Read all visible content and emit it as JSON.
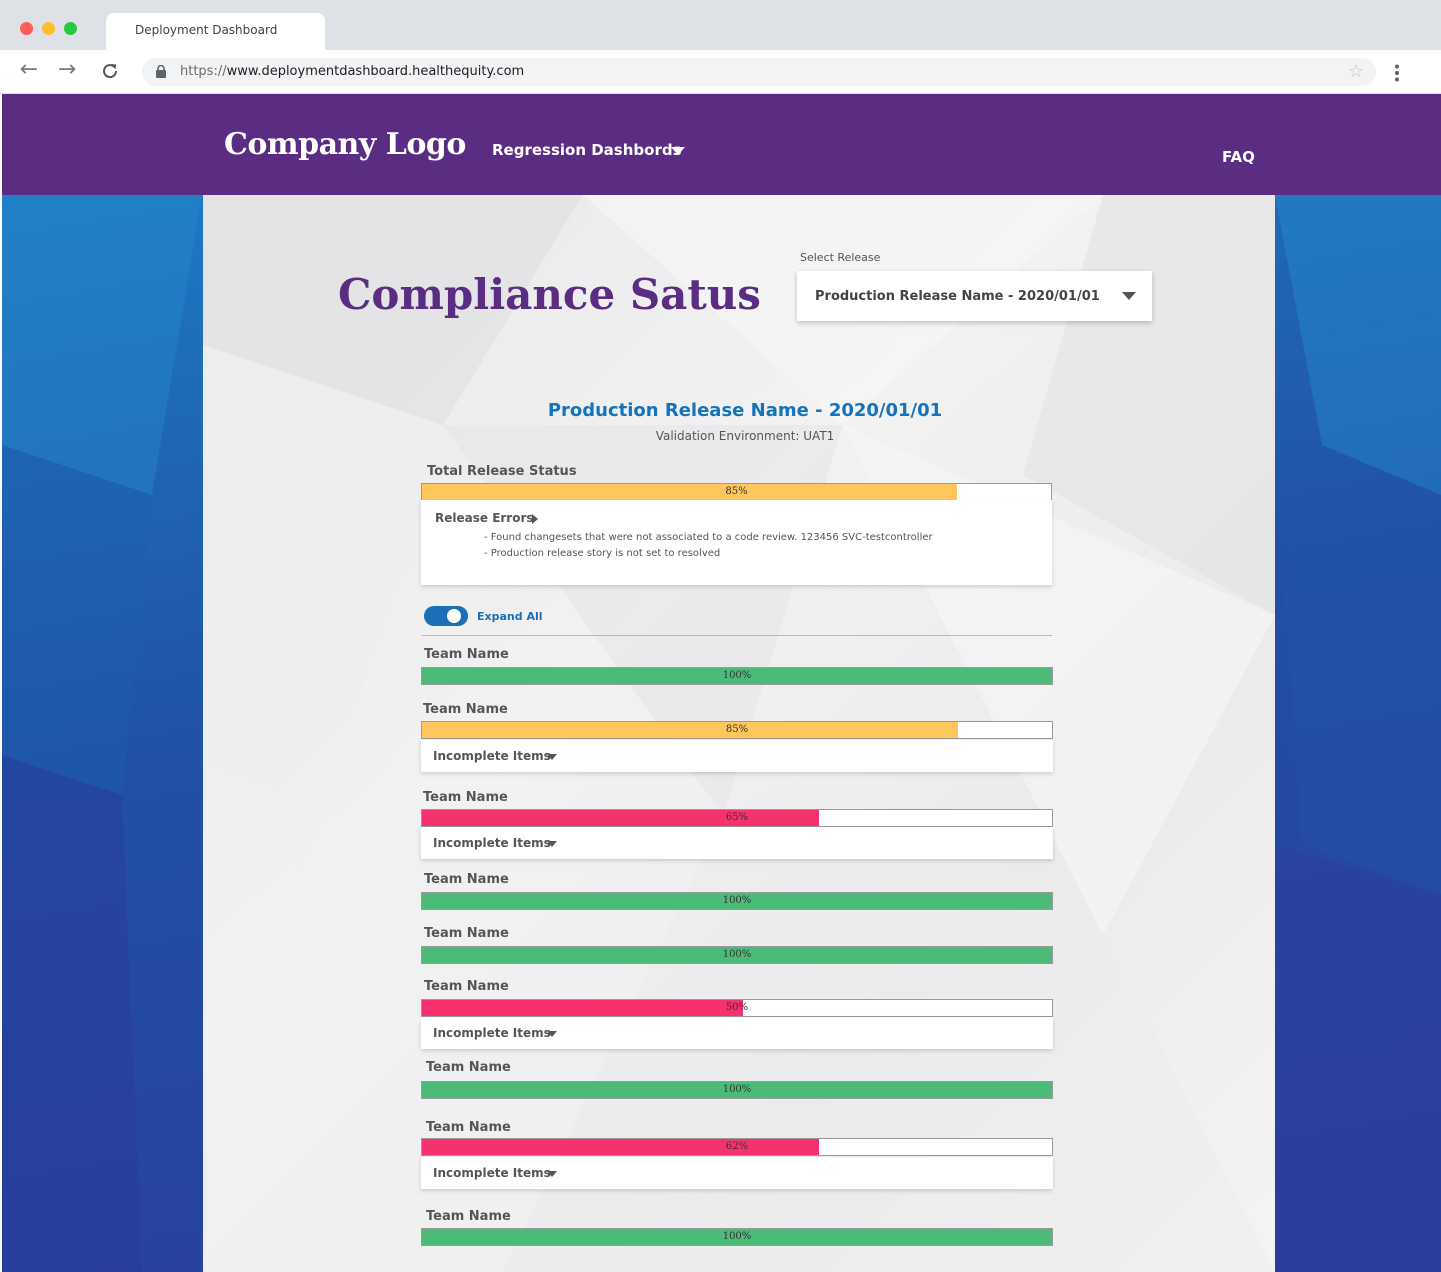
{
  "browser": {
    "tab_title": "Deployment Dashboard",
    "url_scheme": "https://",
    "url_host": "www.deploymentdashboard.healthequity.com"
  },
  "header": {
    "logo": "Company Logo",
    "nav_regression": "Regression Dashbords",
    "nav_faq": "FAQ"
  },
  "page": {
    "title": "Compliance Satus",
    "select_label": "Select Release",
    "selected_release": "Production Release Name - 2020/01/01",
    "release_title": "Production Release Name - 2020/01/01",
    "release_env": "Validation Environment: UAT1"
  },
  "total": {
    "label": "Total Release Status",
    "percent_text": "85%",
    "percent": 85,
    "color": "#ffc65c"
  },
  "errors": {
    "title": "Release Errors",
    "lines": [
      "- Found changesets that were not associated to a code review. 123456 SVC-testcontroller",
      "- Production release story is not set to resolved"
    ]
  },
  "expand_all": "Expand All",
  "colors": {
    "green": "#4cbb7a",
    "yellow": "#ffc65c",
    "red": "#f5326d"
  },
  "teams": [
    {
      "name": "Team Name",
      "percent": 100,
      "percent_text": "100%",
      "status": "green"
    },
    {
      "name": "Team Name",
      "percent": 85,
      "percent_text": "85%",
      "status": "yellow",
      "incomplete_label": "Incomplete Items"
    },
    {
      "name": "Team Name",
      "percent": 63,
      "percent_text": "65%",
      "status": "red",
      "incomplete_label": "Incomplete Items"
    },
    {
      "name": "Team Name",
      "percent": 100,
      "percent_text": "100%",
      "status": "green"
    },
    {
      "name": "Team Name",
      "percent": 100,
      "percent_text": "100%",
      "status": "green"
    },
    {
      "name": "Team Name",
      "percent": 51,
      "percent_text": "50%",
      "status": "red",
      "incomplete_label": "Incomplete Items"
    },
    {
      "name": "Team Name",
      "percent": 100,
      "percent_text": "100%",
      "status": "green"
    },
    {
      "name": "Team Name",
      "percent": 63,
      "percent_text": "62%",
      "status": "red",
      "incomplete_label": "Incomplete Items"
    },
    {
      "name": "Team Name",
      "percent": 100,
      "percent_text": "100%",
      "status": "green"
    }
  ]
}
